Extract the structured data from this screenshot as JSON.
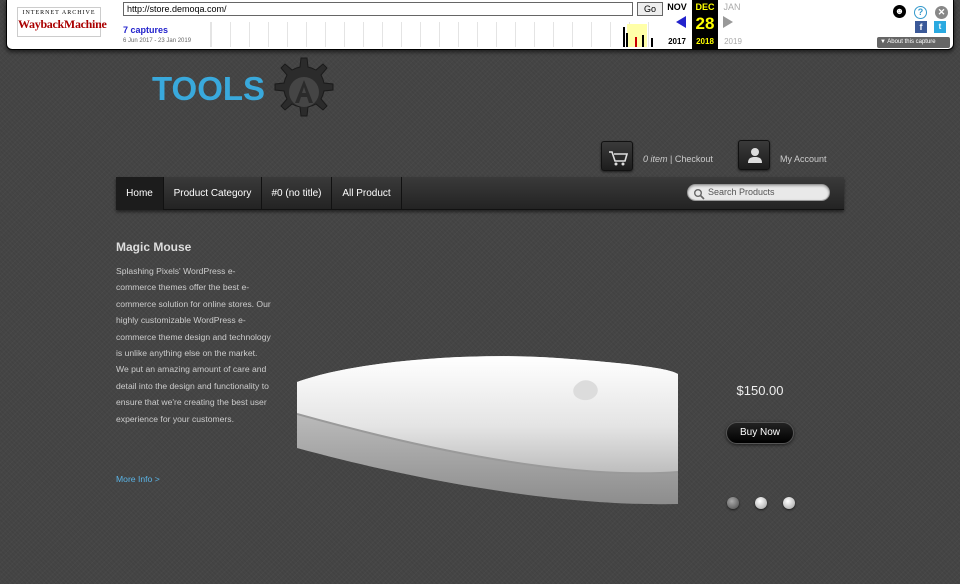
{
  "wayback": {
    "logo_top": "INTERNET ARCHIVE",
    "logo_main": "WaybackMachine",
    "url": "http://store.demoqa.com/",
    "go_label": "Go",
    "captures": "7 captures",
    "range": "6 Jun 2017 - 23 Jan 2019",
    "months": {
      "prev": "NOV",
      "current": "DEC",
      "next": "JAN"
    },
    "day": "28",
    "years": {
      "prev": "2017",
      "current": "2018",
      "next": "2019"
    },
    "about": "About this capture",
    "icons": [
      "user-icon",
      "help-icon",
      "close-icon",
      "facebook-icon",
      "twitter-icon"
    ],
    "colors": {
      "current_year": "#ffff00",
      "captures_link": "#2222cc"
    }
  },
  "site": {
    "logo_text": "TOOLS",
    "cart": {
      "count": "0 item",
      "separator": " | ",
      "checkout": "Checkout"
    },
    "account": "My Account"
  },
  "nav": {
    "items": [
      {
        "label": "Home",
        "active": true
      },
      {
        "label": "Product Category"
      },
      {
        "label": "#0 (no title)"
      },
      {
        "label": "All Product"
      }
    ],
    "search_placeholder": "Search Products"
  },
  "slide": {
    "title": "Magic Mouse",
    "description": "Splashing Pixels' WordPress e-commerce themes offer the best e-commerce solution for online stores. Our highly customizable WordPress e-commerce theme design and technology is unlike anything else on the market. We put an amazing amount of care and detail into the design and functionality to ensure that we're creating the best user experience for your customers.",
    "more_info": "More Info >",
    "price": "$150.00",
    "buy_label": "Buy Now",
    "dots": 3,
    "active_dot": 1
  },
  "colors": {
    "accent": "#39a9dc",
    "link": "#5ab4e6",
    "background": "#454545"
  }
}
